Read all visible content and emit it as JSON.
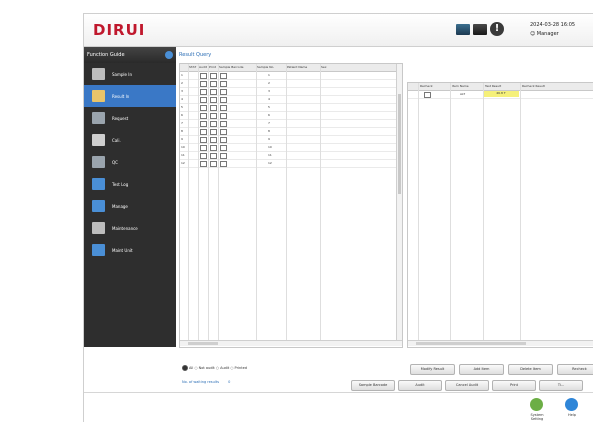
{
  "app": {
    "logo": "DIRUI",
    "datetime_line1": "2024-03-28  16:05",
    "datetime_line2": "☺  Manager",
    "warning_glyph": "!"
  },
  "sidebar": {
    "header": "Function Guide",
    "items": [
      {
        "label": "Sample In",
        "icon": "sample-in-icon",
        "color": "#bdbdbd"
      },
      {
        "label": "Result In",
        "icon": "result-in-icon",
        "color": "#e9c46a",
        "active": true
      },
      {
        "label": "Request",
        "icon": "request-icon",
        "color": "#9aa4ad"
      },
      {
        "label": "Cali.",
        "icon": "calibration-icon",
        "color": "#cfcfcf"
      },
      {
        "label": "QC",
        "icon": "qc-icon",
        "color": "#9aa4ad"
      },
      {
        "label": "Test Log",
        "icon": "test-log-icon",
        "color": "#4a8fd6"
      },
      {
        "label": "Manage",
        "icon": "manage-icon",
        "color": "#4a8fd6"
      },
      {
        "label": "Maintenance",
        "icon": "maintenance-icon",
        "color": "#bdbdbd"
      },
      {
        "label": "Maint Unit",
        "icon": "maint-unit-icon",
        "color": "#4a8fd6"
      }
    ],
    "colors": {
      "bg": "#2e2e2e",
      "active": "#3a78c6"
    }
  },
  "main": {
    "title": "Result Query",
    "left_table": {
      "columns": [
        "",
        "STAT",
        "Audit",
        "Print",
        "Sample Barcode",
        "Sample No.",
        "Patient Name",
        "Sex"
      ],
      "rows": [
        {
          "no": "1",
          "selected": true
        },
        {
          "no": "2"
        },
        {
          "no": "3"
        },
        {
          "no": "4"
        },
        {
          "no": "5"
        },
        {
          "no": "6"
        },
        {
          "no": "7"
        },
        {
          "no": "8"
        },
        {
          "no": "9"
        },
        {
          "no": "10"
        },
        {
          "no": "11"
        },
        {
          "no": "12"
        }
      ]
    },
    "right_table": {
      "columns": [
        "",
        "Recheck",
        "Item Name",
        "Test Result",
        "Recheck Result"
      ],
      "rows": [
        {
          "item": "ALT",
          "result": "46.8 T"
        }
      ]
    },
    "filter": {
      "options": [
        "All",
        "Audited",
        "Unaudited",
        "Printed"
      ],
      "selected": "All",
      "text": "All  ○ Not audit  ○ Audit  ○ Printed"
    },
    "pending": {
      "label": "No. of waiting results",
      "value": "0"
    },
    "buttons_row1": [
      "Modify Result",
      "Add Item",
      "Delete Item",
      "Recheck"
    ],
    "buttons_row2": [
      "Sample Barcode",
      "Audit",
      "Cancel Audit",
      "Print",
      "Ti..."
    ]
  },
  "footer": {
    "buttons": [
      {
        "label": "System Setting",
        "icon": "settings-icon",
        "color": "#6cae45"
      },
      {
        "label": "Help",
        "icon": "help-icon",
        "color": "#2f86d8"
      }
    ]
  }
}
